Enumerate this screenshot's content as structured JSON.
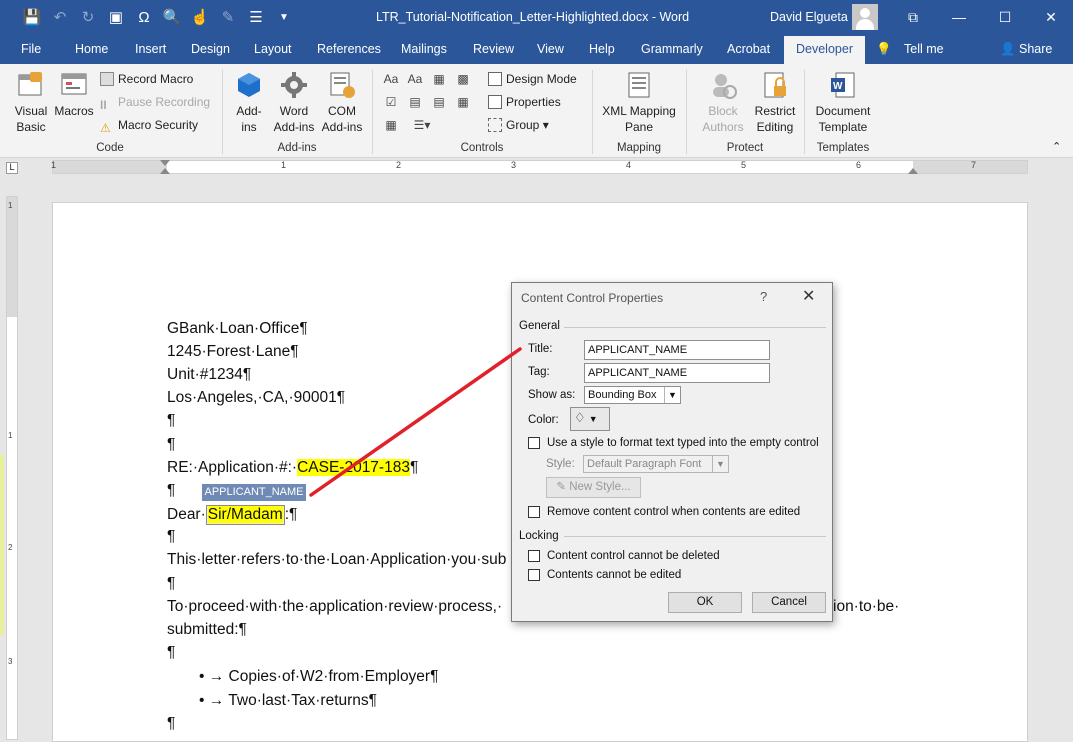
{
  "window": {
    "document_title": "LTR_Tutorial-Notification_Letter-Highlighted.docx  -  Word",
    "user_name": "David Elgueta",
    "controls": {
      "restore": "⧉",
      "minimize": "—",
      "maximize": "☐",
      "close": "✕"
    },
    "quick_access": [
      "save-icon",
      "undo-icon",
      "redo-icon",
      "touch-mode-icon",
      "special-char-icon",
      "print-preview-icon",
      "touch-icon",
      "format-painter-icon",
      "list-icon",
      "customize-icon"
    ]
  },
  "tabs": [
    "File",
    "Home",
    "Insert",
    "Design",
    "Layout",
    "References",
    "Mailings",
    "Review",
    "View",
    "Help",
    "Grammarly",
    "Acrobat",
    "Developer"
  ],
  "active_tab": "Developer",
  "tell_me": "Tell me",
  "share": "Share",
  "ribbon": {
    "code": {
      "label": "Code",
      "visual_basic": "Visual Basic",
      "macros": "Macros",
      "record_macro": "Record Macro",
      "pause_recording": "Pause Recording",
      "macro_security": "Macro Security"
    },
    "addins": {
      "label": "Add-ins",
      "add_ins": "Add-ins",
      "word_add_ins": "Word Add-ins",
      "com_add_ins": "COM Add-ins"
    },
    "controls": {
      "label": "Controls",
      "design_mode": "Design Mode",
      "properties": "Properties",
      "group": "Group"
    },
    "mapping": {
      "label": "Mapping",
      "xml_mapping_pane": "XML Mapping Pane"
    },
    "protect": {
      "label": "Protect",
      "block_authors": "Block Authors",
      "restrict_editing": "Restrict Editing"
    },
    "templates": {
      "label": "Templates",
      "document_template": "Document Template"
    }
  },
  "ruler": {
    "h_numbers": [
      "1",
      "1",
      "2",
      "3",
      "4",
      "5",
      "6",
      "7"
    ],
    "v_numbers": [
      "1",
      "1",
      "2",
      "3"
    ]
  },
  "document": {
    "address": [
      "GBank·Loan·Office¶",
      "1245·Forest·Lane¶",
      "Unit·#1234¶",
      "Los·Angeles,·CA,·90001¶"
    ],
    "blank": "¶",
    "re_prefix": "RE:·Application·#:·",
    "case_number": "CASE-2017-183",
    "re_suffix": "¶",
    "cc_tag": "APPLICANT_NAME",
    "dear_prefix": "Dear·",
    "salutation": "Sir/Madam",
    "dear_suffix": ":¶",
    "para1": "This·letter·refers·to·the·Loan·Application·you·sub",
    "para2a": "To·proceed·with·the·application·review·process,·",
    "para2b_tail": "ion·to·be·",
    "para2c": "submitted:¶",
    "bullets": [
      "→ Copies·of·W2·from·Employer¶",
      "→ Two·last·Tax·returns¶"
    ],
    "bullet_glyph": "•"
  },
  "dialog": {
    "title": "Content Control Properties",
    "help": "?",
    "close": "✕",
    "general": "General",
    "title_label": "Title:",
    "title_value": "APPLICANT_NAME",
    "tag_label": "Tag:",
    "tag_value": "APPLICANT_NAME",
    "show_as_label": "Show as:",
    "show_as_value": "Bounding Box",
    "color_label": "Color:",
    "use_style_label": "Use a style to format text typed into the empty control",
    "style_label": "Style:",
    "style_value": "Default Paragraph Font",
    "new_style": "New Style...",
    "remove_label": "Remove content control when contents are edited",
    "locking": "Locking",
    "cannot_delete": "Content control cannot be deleted",
    "cannot_edit": "Contents cannot be edited",
    "ok": "OK",
    "cancel": "Cancel"
  },
  "colors": {
    "title_bar": "#2b579a",
    "highlight": "#ffff00",
    "cc_tag": "#6f8bb5",
    "annotation_arrow": "#e0202a"
  }
}
